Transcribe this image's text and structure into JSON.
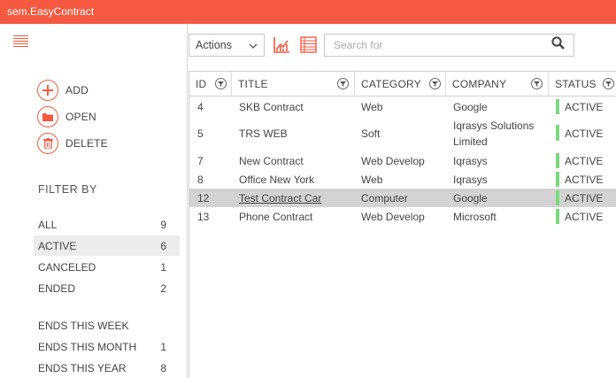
{
  "app": {
    "title": "sem.EasyContract"
  },
  "actions": {
    "add": "ADD",
    "open": "OPEN",
    "delete": "DELETE"
  },
  "filter": {
    "title": "FILTER BY",
    "items": [
      {
        "label": "ALL",
        "count": "9"
      },
      {
        "label": "ACTIVE",
        "count": "6",
        "selected": true
      },
      {
        "label": "CANCELED",
        "count": "1"
      },
      {
        "label": "ENDED",
        "count": "2"
      },
      {
        "label": "ENDS THIS WEEK",
        "count": ""
      },
      {
        "label": "ENDS THIS MONTH",
        "count": "1"
      },
      {
        "label": "ENDS THIS YEAR",
        "count": "8"
      }
    ]
  },
  "toolbar": {
    "actions_label": "Actions",
    "search_placeholder": "Search for",
    "chart_icon": "chart-icon",
    "table_icon": "table-icon",
    "search_icon": "search-icon"
  },
  "grid": {
    "columns": [
      "ID",
      "TITLE",
      "CATEGORY",
      "COMPANY",
      "STATUS"
    ],
    "rows": [
      {
        "id": "4",
        "title": "SKB Contract",
        "category": "Web",
        "company": "Google",
        "status": "ACTIVE"
      },
      {
        "id": "5",
        "title": "TRS WEB",
        "category": "Soft",
        "company": "Iqrasys Solutions Limited",
        "status": "ACTIVE"
      },
      {
        "id": "7",
        "title": "New Contract",
        "category": "Web Develop",
        "company": "Iqrasys",
        "status": "ACTIVE"
      },
      {
        "id": "8",
        "title": "Office New York",
        "category": "Web",
        "company": "Iqrasys",
        "status": "ACTIVE"
      },
      {
        "id": "12",
        "title": "Test Contract Car",
        "category": "Computer",
        "company": "Google",
        "status": "ACTIVE",
        "selected": true
      },
      {
        "id": "13",
        "title": "Phone Contract",
        "category": "Web Develop",
        "company": "Microsoft",
        "status": "ACTIVE"
      }
    ]
  },
  "colors": {
    "accent": "#f55a41",
    "status_active": "#7ad87e",
    "selected_row": "#d3d3d3",
    "selected_filter": "#ececec"
  }
}
